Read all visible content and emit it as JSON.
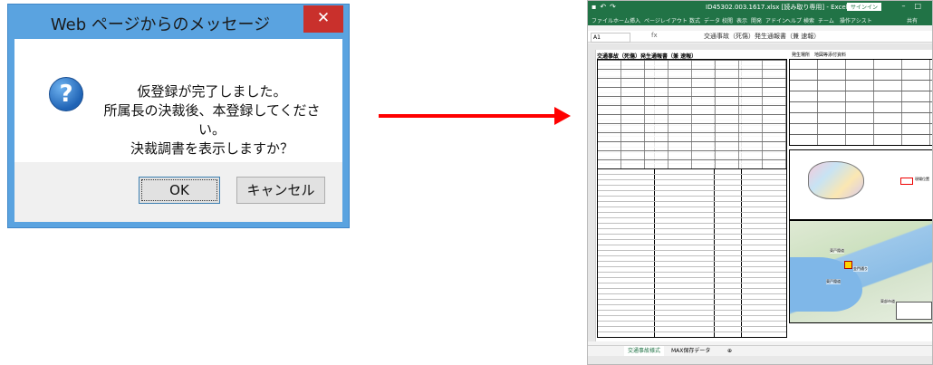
{
  "dialog": {
    "title": "Web ページからのメッセージ",
    "close_glyph": "✕",
    "icon_glyph": "?",
    "message_lines": [
      "仮登録が完了しました。",
      "所属長の決裁後、本登録してください。",
      "決裁調書を表示しますか？"
    ],
    "ok_label": "OK",
    "cancel_label": "キャンセル"
  },
  "excel": {
    "window_title": "ID45302.003.1617.xlsx [読み取り専用] - Excel",
    "signin_label": "サインイン",
    "ribbon_tabs": [
      "ファイル",
      "ホーム",
      "挿入",
      "ページレイアウト",
      "数式",
      "データ",
      "校閲",
      "表示",
      "開発",
      "アドイン",
      "ヘルプ",
      "検索",
      "チーム",
      "操作アシスト",
      "共有"
    ],
    "name_box": "A1",
    "formula_text": "交通事故（死傷）発生通報書（兼 速報）",
    "form_title": "交通事故（死傷）発生通報書（兼 速報）",
    "form_title_right": "発生場所　地図等添付資料",
    "map_labels": [
      "東戸隠道",
      "金門通り",
      "東戸隠道",
      "東部市道"
    ],
    "legend_label": "現場位置",
    "sheet_tabs": [
      "交通事故様式",
      "MAX保存データ"
    ],
    "colors": {
      "excel_green": "#217346",
      "arrow_red": "#ff0000",
      "dialog_frame": "#5aa3e0",
      "close_red": "#c9302c"
    }
  }
}
